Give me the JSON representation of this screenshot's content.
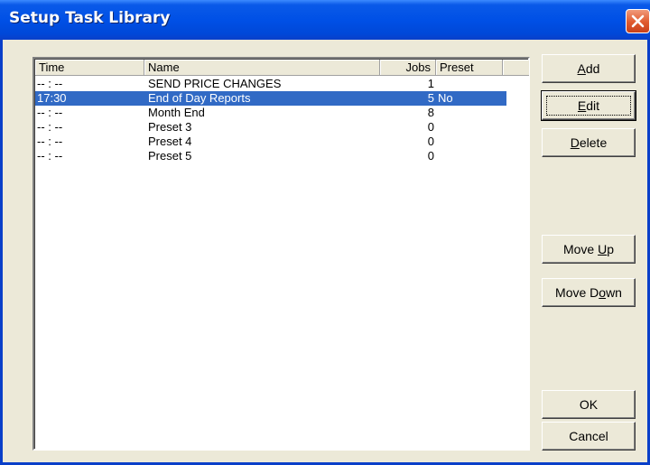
{
  "window": {
    "title": "Setup Task Library"
  },
  "listview": {
    "columns": {
      "time": "Time",
      "name": "Name",
      "jobs": "Jobs",
      "preset": "Preset"
    },
    "rows": [
      {
        "time": "-- : --",
        "name": "SEND PRICE CHANGES",
        "jobs": "1",
        "preset": "",
        "selected": false
      },
      {
        "time": "17:30",
        "name": "End of Day Reports",
        "jobs": "5",
        "preset": "No",
        "selected": true
      },
      {
        "time": "-- : --",
        "name": "Month End",
        "jobs": "8",
        "preset": "",
        "selected": false
      },
      {
        "time": "-- : --",
        "name": "Preset 3",
        "jobs": "0",
        "preset": "",
        "selected": false
      },
      {
        "time": "-- : --",
        "name": "Preset 4",
        "jobs": "0",
        "preset": "",
        "selected": false
      },
      {
        "time": "-- : --",
        "name": "Preset 5",
        "jobs": "0",
        "preset": "",
        "selected": false
      }
    ]
  },
  "buttons": {
    "add": {
      "pre": "",
      "key": "A",
      "post": "dd"
    },
    "edit": {
      "pre": "",
      "key": "E",
      "post": "dit"
    },
    "delete": {
      "pre": "",
      "key": "D",
      "post": "elete"
    },
    "move_up": {
      "pre": "Move ",
      "key": "U",
      "post": "p"
    },
    "move_down": {
      "pre": "Move D",
      "key": "o",
      "post": "wn"
    },
    "ok": {
      "pre": "OK",
      "key": "",
      "post": ""
    },
    "cancel": {
      "pre": "Cancel",
      "key": "",
      "post": ""
    }
  },
  "colors": {
    "titlebar": "#0050e6",
    "selection": "#316ac5",
    "dialog_face": "#ece9d8",
    "close_button": "#e05a2e"
  },
  "icons": {
    "close": "close-icon"
  }
}
